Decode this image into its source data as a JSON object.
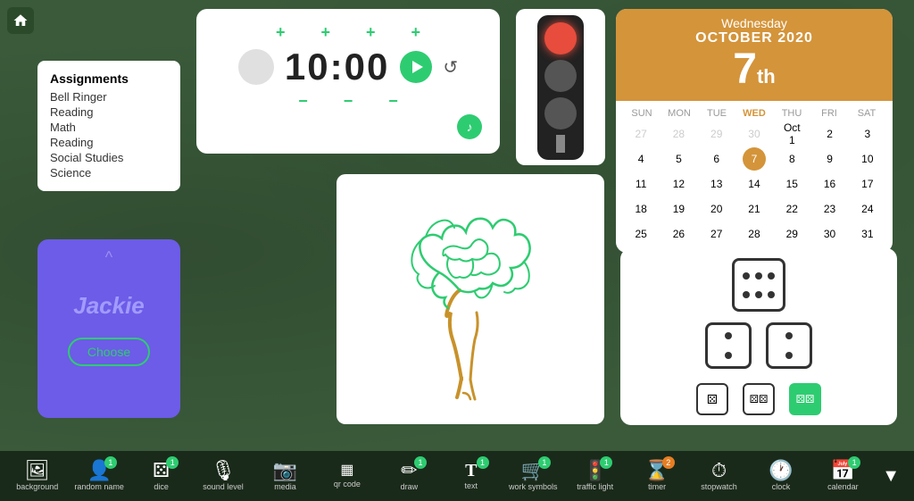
{
  "home": {
    "label": "home"
  },
  "assignments": {
    "title": "Assignments",
    "items": [
      "Bell Ringer",
      "Reading",
      "Math",
      "Reading",
      "Social Studies",
      "Science"
    ]
  },
  "timer": {
    "display": "10:00",
    "plus_labels": [
      "+",
      "+",
      "+",
      "+"
    ],
    "minus_labels": [
      "−",
      "−",
      "−",
      "−"
    ]
  },
  "calendar": {
    "day_name": "Wednesday",
    "month_year": "OCTOBER 2020",
    "day_num": "7",
    "suffix": "th",
    "weekdays": [
      "SUN",
      "MON",
      "TUE",
      "WED",
      "THU",
      "FRI",
      "SAT"
    ],
    "weeks": [
      [
        "27",
        "28",
        "29",
        "30",
        "Oct 1",
        "2",
        "3"
      ],
      [
        "4",
        "5",
        "6",
        "7",
        "8",
        "9",
        "10"
      ],
      [
        "11",
        "12",
        "13",
        "14",
        "15",
        "16",
        "17"
      ],
      [
        "18",
        "19",
        "20",
        "21",
        "22",
        "23",
        "24"
      ],
      [
        "25",
        "26",
        "27",
        "28",
        "29",
        "30",
        "31"
      ]
    ]
  },
  "user": {
    "name": "Jackie",
    "choose_label": "Choose"
  },
  "toolbar": {
    "items": [
      {
        "id": "background",
        "label": "background",
        "icon": "🖼",
        "badge": null
      },
      {
        "id": "random-name",
        "label": "random name",
        "icon": "👤",
        "badge": "1"
      },
      {
        "id": "dice",
        "label": "dice",
        "icon": "⚄",
        "badge": "1"
      },
      {
        "id": "sound-level",
        "label": "sound level",
        "icon": "🎙",
        "badge": null
      },
      {
        "id": "media",
        "label": "media",
        "icon": "📷",
        "badge": null
      },
      {
        "id": "qr-code",
        "label": "qr code",
        "icon": "⊞",
        "badge": null
      },
      {
        "id": "draw",
        "label": "draw",
        "icon": "✏",
        "badge": "1"
      },
      {
        "id": "text",
        "label": "text",
        "icon": "T",
        "badge": "1"
      },
      {
        "id": "work-symbols",
        "label": "work symbols",
        "icon": "🛒",
        "badge": "1"
      },
      {
        "id": "traffic-light",
        "label": "traffic light",
        "icon": "🚦",
        "badge": "1"
      },
      {
        "id": "timer",
        "label": "timer",
        "icon": "⌛",
        "badge": "2",
        "badge_type": "orange"
      },
      {
        "id": "stopwatch",
        "label": "stopwatch",
        "icon": "⏱",
        "badge": null
      },
      {
        "id": "clock",
        "label": "clock",
        "icon": "🕐",
        "badge": null
      },
      {
        "id": "calendar",
        "label": "calendar",
        "icon": "📅",
        "badge": "1"
      }
    ],
    "arrow_label": "▼"
  }
}
